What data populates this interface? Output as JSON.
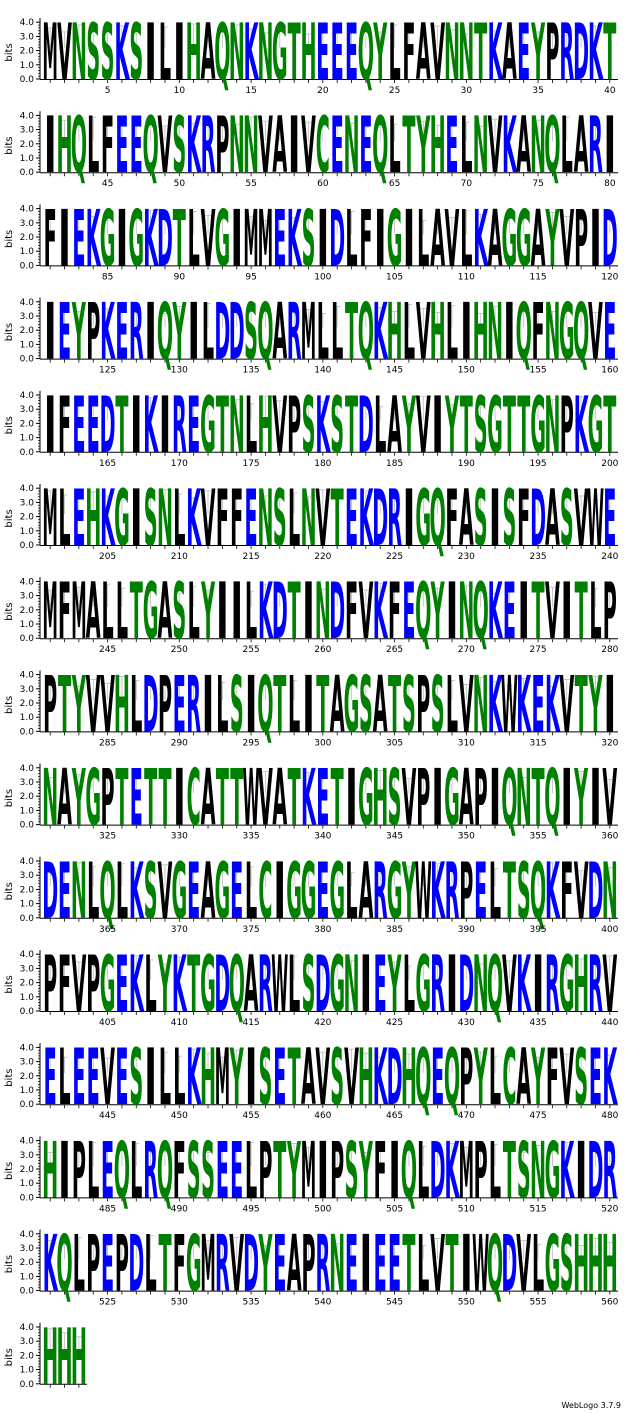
{
  "chart_data": {
    "type": "sequence-logo",
    "ylabel": "bits",
    "ylim": [
      0,
      4.3
    ],
    "yticks": [
      "0.0",
      "1.0",
      "2.0",
      "3.0",
      "4.0"
    ],
    "positions_per_row": 40,
    "x_tick_step": 5,
    "sequence": "MVNSSKSILIHAQNKNGTHEEEQYLFAVNNTKAEYPRDKTIHQLFEEQVSKRPNNVAIVCENEQLTYHELNVKANQLARIFIEKGIGKDTLVGIMMEKSIDLFIGILAVLKAGGAYVPIDIEYPKERIQYILDDSQARMLLTQKHLVHLIHNIQFNGQVEIFEEDTIKIREGTNLHVPSKSTDLAYVIYTSGTTGNPKGTMLEHKGISNLKVFFENSLNVTEKDRIGQFASISFDASVWEMFMALLTGASLYIILKDTINDFVKFEQYINQKEITVITLPPTYVVHLDPERILSIQTLITAGSATSPSLVNKWKEKVTYINAYGPTETTICATTWVATKETIGHSVPIGAPIQNTQIYIVDENLQLKSVGEAGELCIGGEGLARGYWKRPELTSQKFVDNPFVPGEKLYKTGDQARWLSDGNIEYLGRIDNQVKIRGHRVELEEVESILLKHMYISETAVSVHKDHQEQPYLCAYFVSEKHIPLEQLRQFSSEELPTYMIPSYFIQLDKMPLTSNGKIDRKQLPEPDLTFGMRVDYEAPRNEIEETLVTIWQDVLGSHHHHHH",
    "letter_height_bits": 4.0,
    "colors": {
      "polar": "#008000",
      "basic": "#0000ff",
      "acidic": "#0000ff",
      "hydrophobic": "#000000",
      "error_bar": "#bbbbbb"
    },
    "color_groups": {
      "polar": "GSTYCNQH",
      "basic": "KR",
      "acidic": "DE",
      "hydrophobic": "AVLIPWFM"
    }
  },
  "footer": {
    "credit": "WebLogo 3.7.9"
  }
}
